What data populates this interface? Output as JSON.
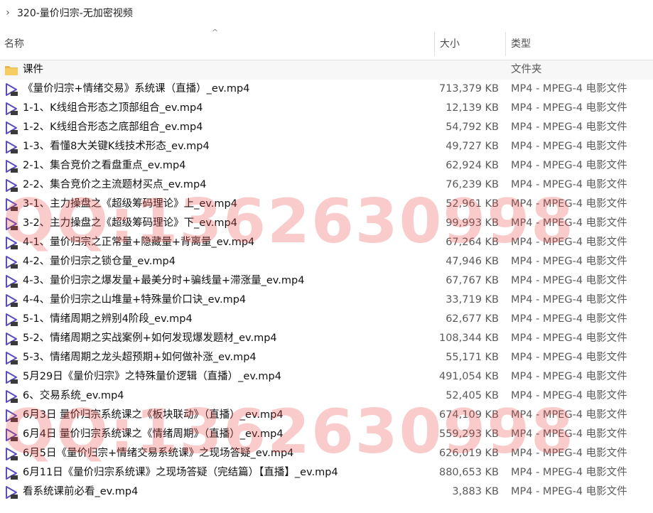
{
  "breadcrumb": {
    "path": "320-量价归宗-无加密视频"
  },
  "columns": {
    "name": "名称",
    "size": "大小",
    "type": "类型"
  },
  "watermark": {
    "text": "QQ:1362630998"
  },
  "folder": {
    "name": "课件",
    "type": "文件夹",
    "icon": "folder-icon",
    "color": "#e8b84a"
  },
  "files": [
    {
      "name": "《量价归宗+情绪交易》系统课（直播）_ev.mp4",
      "size": "713,379 KB",
      "type": "MP4 - MPEG-4 电影文件"
    },
    {
      "name": "1-1、K线组合形态之顶部组合_ev.mp4",
      "size": "12,139 KB",
      "type": "MP4 - MPEG-4 电影文件"
    },
    {
      "name": "1-2、K线组合形态之底部组合_ev.mp4",
      "size": "54,792 KB",
      "type": "MP4 - MPEG-4 电影文件"
    },
    {
      "name": "1-3、看懂8大关键K线技术形态_ev.mp4",
      "size": "49,727 KB",
      "type": "MP4 - MPEG-4 电影文件"
    },
    {
      "name": "2-1、集合竞价之看盘重点_ev.mp4",
      "size": "62,924 KB",
      "type": "MP4 - MPEG-4 电影文件"
    },
    {
      "name": "2-2、集合竞价之主流题材买点_ev.mp4",
      "size": "76,239 KB",
      "type": "MP4 - MPEG-4 电影文件"
    },
    {
      "name": "3-1、主力操盘之《超级筹码理论》上_ev.mp4",
      "size": "52,961 KB",
      "type": "MP4 - MPEG-4 电影文件"
    },
    {
      "name": "3-2、主力操盘之《超级筹码理论》下_ev.mp4",
      "size": "99,993 KB",
      "type": "MP4 - MPEG-4 电影文件"
    },
    {
      "name": "4-1、量价归宗之正常量+隐藏量+背离量_ev.mp4",
      "size": "67,264 KB",
      "type": "MP4 - MPEG-4 电影文件"
    },
    {
      "name": "4-2、量价归宗之锁仓量_ev.mp4",
      "size": "47,946 KB",
      "type": "MP4 - MPEG-4 电影文件"
    },
    {
      "name": "4-3、量价归宗之爆发量+最美分时+骗线量+滞涨量_ev.mp4",
      "size": "67,767 KB",
      "type": "MP4 - MPEG-4 电影文件"
    },
    {
      "name": "4-4、量价归宗之山堆量+特殊量价口诀_ev.mp4",
      "size": "33,719 KB",
      "type": "MP4 - MPEG-4 电影文件"
    },
    {
      "name": "5-1、情绪周期之辨别4阶段_ev.mp4",
      "size": "62,677 KB",
      "type": "MP4 - MPEG-4 电影文件"
    },
    {
      "name": "5-2、情绪周期之实战案例+如何发现爆发题材_ev.mp4",
      "size": "108,344 KB",
      "type": "MP4 - MPEG-4 电影文件"
    },
    {
      "name": "5-3、情绪周期之龙头超预期+如何做补涨_ev.mp4",
      "size": "55,171 KB",
      "type": "MP4 - MPEG-4 电影文件"
    },
    {
      "name": "5月29日《量价归宗》之特殊量价逻辑（直播）_ev.mp4",
      "size": "491,054 KB",
      "type": "MP4 - MPEG-4 电影文件"
    },
    {
      "name": "6、交易系统_ev.mp4",
      "size": "52,405 KB",
      "type": "MP4 - MPEG-4 电影文件"
    },
    {
      "name": "6月3日 量价归宗系统课之《板块联动》（直播）_ev.mp4",
      "size": "674,109 KB",
      "type": "MP4 - MPEG-4 电影文件"
    },
    {
      "name": "6月4日 量价归宗系统课之《情绪周期》（直播）_ev.mp4",
      "size": "559,293 KB",
      "type": "MP4 - MPEG-4 电影文件"
    },
    {
      "name": "6月5日《量价归宗+情绪交易系统课》之现场答疑_ev.mp4",
      "size": "626,019 KB",
      "type": "MP4 - MPEG-4 电影文件"
    },
    {
      "name": "6月11日《量价归宗系统课》之现场答疑（完结篇）【直播】_ev.mp4",
      "size": "880,653 KB",
      "type": "MP4 - MPEG-4 电影文件"
    },
    {
      "name": "看系统课前必看_ev.mp4",
      "size": "3,883 KB",
      "type": "MP4 - MPEG-4 电影文件"
    }
  ],
  "colors": {
    "video_icon": "#5a4fc0",
    "header_text": "#4d4d4d",
    "watermark": "#eb4646"
  }
}
